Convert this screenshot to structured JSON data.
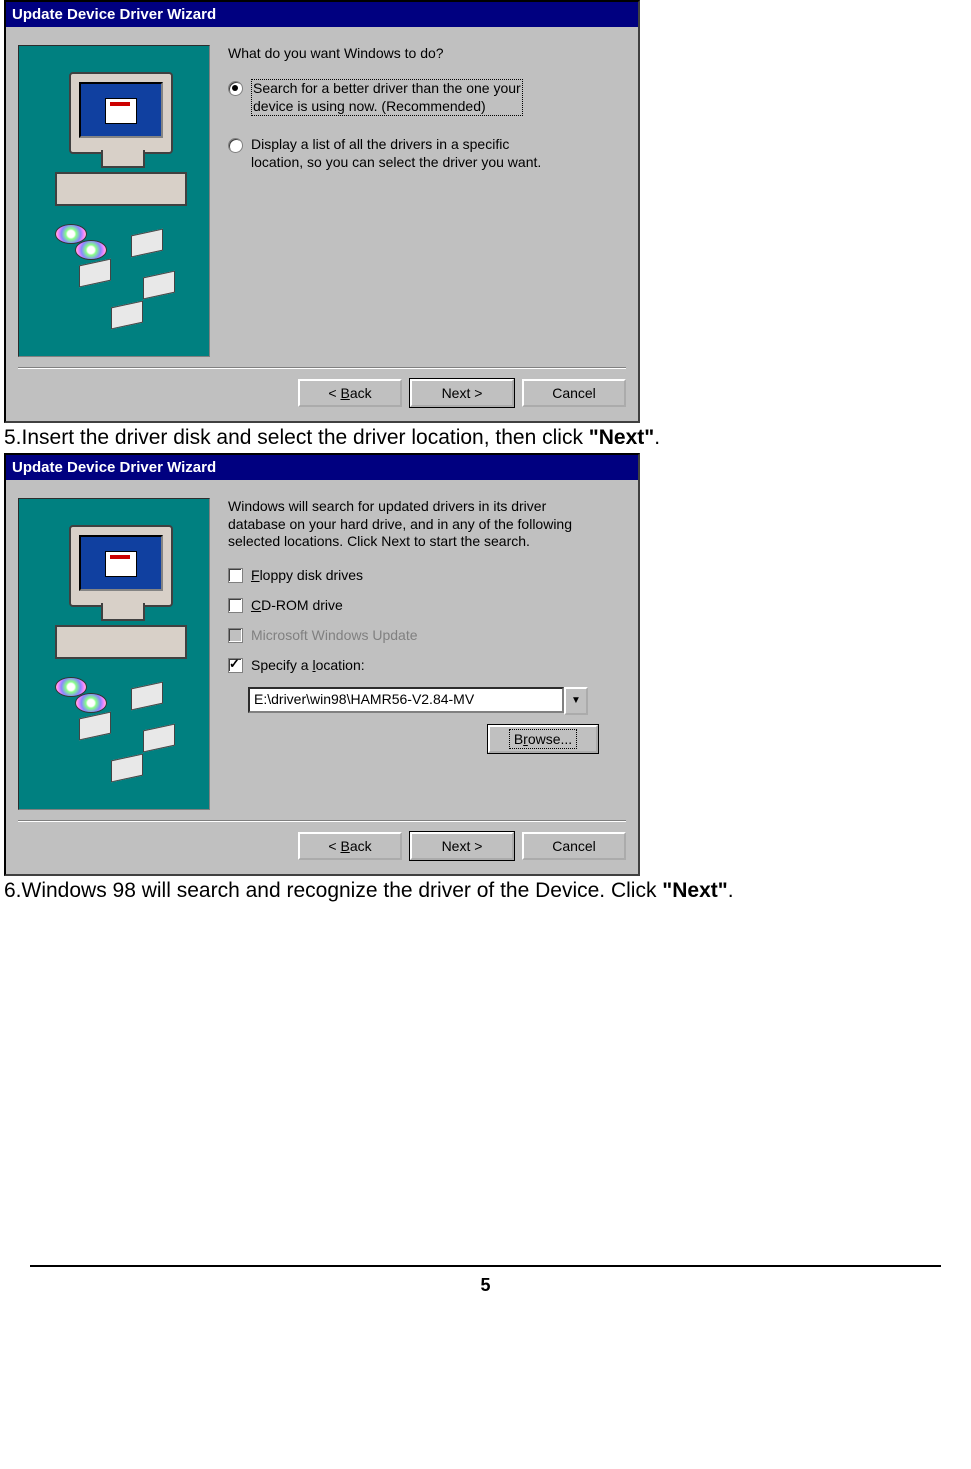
{
  "dialog1": {
    "title": "Update Device Driver Wizard",
    "prompt": "What do you want Windows to do?",
    "option1_line1": "Search for a better driver than the one your",
    "option1_line2": "device is using now. (Recommended)",
    "option2_line1": "Display a list of all the drivers in a specific",
    "option2_line2": "location, so you can select the driver you want.",
    "back": "< Back",
    "next": "Next >",
    "cancel": "Cancel"
  },
  "caption1_a": "5.Insert the driver disk and select the driver location, then click ",
  "caption1_b": "\"Next\"",
  "caption1_c": ".",
  "dialog2": {
    "title": "Update Device Driver Wizard",
    "intro1": "Windows will search for updated drivers in its driver",
    "intro2": "database on your hard drive, and in any of the following",
    "intro3": "selected locations. Click Next to start the search.",
    "chk_floppy": "Floppy disk drives",
    "chk_cdrom": "CD-ROM drive",
    "chk_winupd": "Microsoft Windows Update",
    "chk_specify": "Specify a location:",
    "path": "E:\\driver\\win98\\HAMR56-V2.84-MV",
    "browse": "Browse...",
    "back": "< Back",
    "next": "Next >",
    "cancel": "Cancel"
  },
  "caption2_a": "6.Windows 98 will search and recognize the driver of the Device. Click ",
  "caption2_b": "\"Next\"",
  "caption2_c": ".",
  "page_number": "5"
}
